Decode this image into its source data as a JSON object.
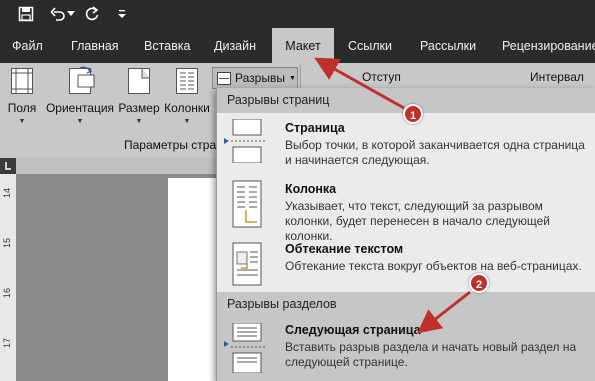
{
  "tabs": [
    {
      "label": "Файл"
    },
    {
      "label": "Главная"
    },
    {
      "label": "Вставка"
    },
    {
      "label": "Дизайн"
    },
    {
      "label": "Макет"
    },
    {
      "label": "Ссылки"
    },
    {
      "label": "Рассылки"
    },
    {
      "label": "Рецензирование"
    }
  ],
  "ribbon": {
    "buttons": [
      {
        "label": "Поля"
      },
      {
        "label": "Ориентация"
      },
      {
        "label": "Размер"
      },
      {
        "label": "Колонки"
      }
    ],
    "group_label": "Параметры стра",
    "breaks_label": "Разрывы",
    "indent_label": "Отступ",
    "spacing_label": "Интервал"
  },
  "menu": {
    "page_breaks_header": "Разрывы страниц",
    "section_breaks_header": "Разрывы разделов",
    "items": [
      {
        "title": "Страница",
        "desc": "Выбор точки, в которой заканчивается одна страница и начинается следующая."
      },
      {
        "title": "Колонка",
        "desc": "Указывает, что текст, следующий за разрывом колонки, будет перенесен в начало следующей колонки."
      },
      {
        "title": "Обтекание текстом",
        "desc": "Обтекание текста вокруг объектов на веб-страницах."
      },
      {
        "title": "Следующая страница",
        "desc": "Вставить разрыв раздела и начать новый раздел на следующей странице."
      }
    ]
  },
  "ruler": {
    "numbers": [
      "14",
      "15",
      "16",
      "17"
    ]
  },
  "callouts": {
    "first": "1",
    "second": "2"
  },
  "colors": {
    "accent": "#c0302a",
    "ribbon": "#c8c8c8",
    "titlebar": "#2b2b2b"
  }
}
